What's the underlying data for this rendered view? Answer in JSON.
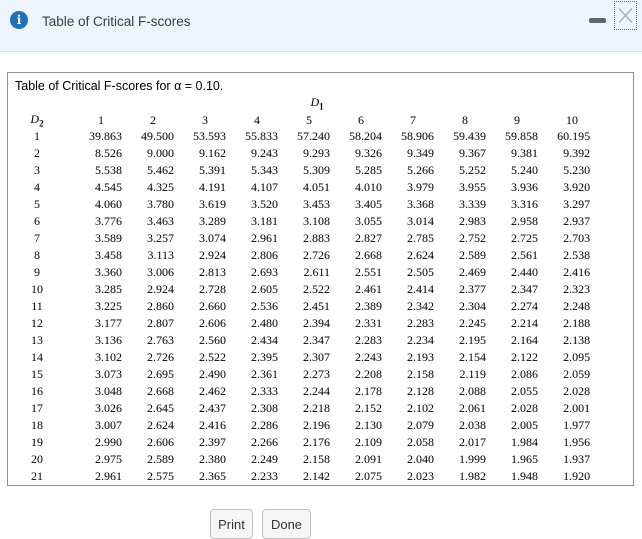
{
  "titlebar": {
    "title": "Table of Critical F-scores"
  },
  "panel": {
    "caption": "Table of Critical F-scores for α = 0.10."
  },
  "table": {
    "d1_label": {
      "base": "D",
      "sub": "1"
    },
    "d2_label": {
      "base": "D",
      "sub": "2"
    },
    "col_headers": [
      "1",
      "2",
      "3",
      "4",
      "5",
      "6",
      "7",
      "8",
      "9",
      "10"
    ],
    "rows": [
      {
        "d2": "1",
        "values": [
          "39.863",
          "49.500",
          "53.593",
          "55.833",
          "57.240",
          "58.204",
          "58.906",
          "59.439",
          "59.858",
          "60.195"
        ]
      },
      {
        "d2": "2",
        "values": [
          "8.526",
          "9.000",
          "9.162",
          "9.243",
          "9.293",
          "9.326",
          "9.349",
          "9.367",
          "9.381",
          "9.392"
        ]
      },
      {
        "d2": "3",
        "values": [
          "5.538",
          "5.462",
          "5.391",
          "5.343",
          "5.309",
          "5.285",
          "5.266",
          "5.252",
          "5.240",
          "5.230"
        ]
      },
      {
        "d2": "4",
        "values": [
          "4.545",
          "4.325",
          "4.191",
          "4.107",
          "4.051",
          "4.010",
          "3.979",
          "3.955",
          "3.936",
          "3.920"
        ]
      },
      {
        "d2": "5",
        "values": [
          "4.060",
          "3.780",
          "3.619",
          "3.520",
          "3.453",
          "3.405",
          "3.368",
          "3.339",
          "3.316",
          "3.297"
        ]
      },
      {
        "d2": "6",
        "values": [
          "3.776",
          "3.463",
          "3.289",
          "3.181",
          "3.108",
          "3.055",
          "3.014",
          "2.983",
          "2.958",
          "2.937"
        ]
      },
      {
        "d2": "7",
        "values": [
          "3.589",
          "3.257",
          "3.074",
          "2.961",
          "2.883",
          "2.827",
          "2.785",
          "2.752",
          "2.725",
          "2.703"
        ]
      },
      {
        "d2": "8",
        "values": [
          "3.458",
          "3.113",
          "2.924",
          "2.806",
          "2.726",
          "2.668",
          "2.624",
          "2.589",
          "2.561",
          "2.538"
        ]
      },
      {
        "d2": "9",
        "values": [
          "3.360",
          "3.006",
          "2.813",
          "2.693",
          "2.611",
          "2.551",
          "2.505",
          "2.469",
          "2.440",
          "2.416"
        ]
      },
      {
        "d2": "10",
        "values": [
          "3.285",
          "2.924",
          "2.728",
          "2.605",
          "2.522",
          "2.461",
          "2.414",
          "2.377",
          "2.347",
          "2.323"
        ]
      },
      {
        "d2": "11",
        "values": [
          "3.225",
          "2.860",
          "2.660",
          "2.536",
          "2.451",
          "2.389",
          "2.342",
          "2.304",
          "2.274",
          "2.248"
        ]
      },
      {
        "d2": "12",
        "values": [
          "3.177",
          "2.807",
          "2.606",
          "2.480",
          "2.394",
          "2.331",
          "2.283",
          "2.245",
          "2.214",
          "2.188"
        ]
      },
      {
        "d2": "13",
        "values": [
          "3.136",
          "2.763",
          "2.560",
          "2.434",
          "2.347",
          "2.283",
          "2.234",
          "2.195",
          "2.164",
          "2.138"
        ]
      },
      {
        "d2": "14",
        "values": [
          "3.102",
          "2.726",
          "2.522",
          "2.395",
          "2.307",
          "2.243",
          "2.193",
          "2.154",
          "2.122",
          "2.095"
        ]
      },
      {
        "d2": "15",
        "values": [
          "3.073",
          "2.695",
          "2.490",
          "2.361",
          "2.273",
          "2.208",
          "2.158",
          "2.119",
          "2.086",
          "2.059"
        ]
      },
      {
        "d2": "16",
        "values": [
          "3.048",
          "2.668",
          "2.462",
          "2.333",
          "2.244",
          "2.178",
          "2.128",
          "2.088",
          "2.055",
          "2.028"
        ]
      },
      {
        "d2": "17",
        "values": [
          "3.026",
          "2.645",
          "2.437",
          "2.308",
          "2.218",
          "2.152",
          "2.102",
          "2.061",
          "2.028",
          "2.001"
        ]
      },
      {
        "d2": "18",
        "values": [
          "3.007",
          "2.624",
          "2.416",
          "2.286",
          "2.196",
          "2.130",
          "2.079",
          "2.038",
          "2.005",
          "1.977"
        ]
      },
      {
        "d2": "19",
        "values": [
          "2.990",
          "2.606",
          "2.397",
          "2.266",
          "2.176",
          "2.109",
          "2.058",
          "2.017",
          "1.984",
          "1.956"
        ]
      },
      {
        "d2": "20",
        "values": [
          "2.975",
          "2.589",
          "2.380",
          "2.249",
          "2.158",
          "2.091",
          "2.040",
          "1.999",
          "1.965",
          "1.937"
        ]
      },
      {
        "d2": "21",
        "values": [
          "2.961",
          "2.575",
          "2.365",
          "2.233",
          "2.142",
          "2.075",
          "2.023",
          "1.982",
          "1.948",
          "1.920"
        ]
      }
    ]
  },
  "footer": {
    "print_label": "Print",
    "done_label": "Done"
  },
  "colors": {
    "accent_blue": "#1d72b8",
    "titlebar_bg": "#eef4fc",
    "panel_border": "#8f8f8f"
  }
}
